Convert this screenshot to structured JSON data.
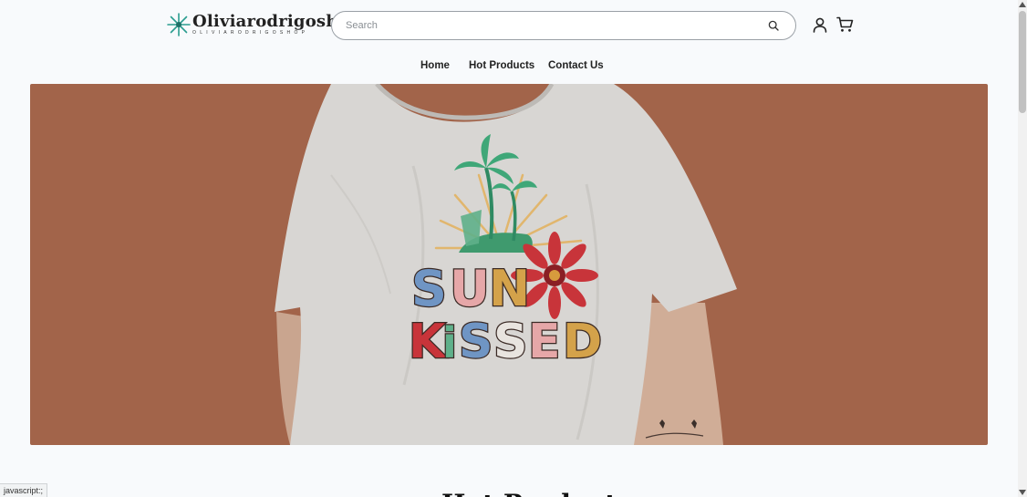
{
  "header": {
    "logo_name": "Oliviarodrigoshop",
    "logo_subtitle": "OLIVIARODRIGOSHOP",
    "logo_icon": "teal-starburst-icon",
    "search": {
      "placeholder": "Search",
      "value": ""
    },
    "icons": [
      "search-icon",
      "user-icon",
      "cart-icon"
    ]
  },
  "nav": {
    "items": [
      {
        "label": "Home"
      },
      {
        "label": "Hot Products"
      },
      {
        "label": "Contact Us"
      }
    ]
  },
  "hero": {
    "background_color": "#a2644a",
    "shirt_color": "#d8d6d3",
    "graphic_text_line1": "SUN",
    "graphic_text_line2": "KiSSED"
  },
  "section": {
    "title": "Hot Products"
  },
  "status_bar": {
    "text": "javascript:;"
  },
  "colors": {
    "page_background": "#f8fafc",
    "logo_accent": "#2a9d8f",
    "text": "#222222"
  }
}
